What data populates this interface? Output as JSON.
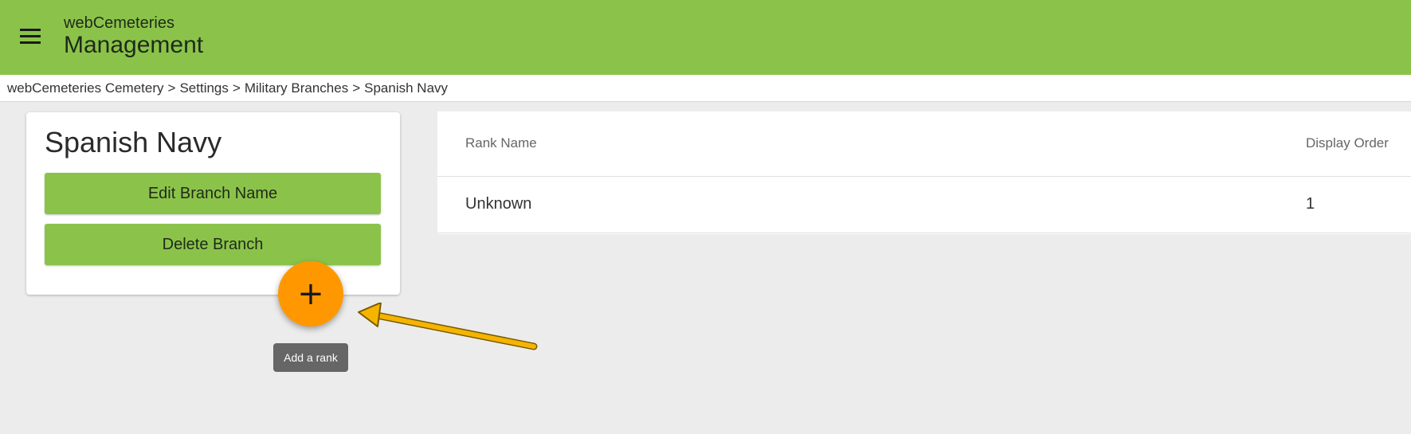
{
  "colors": {
    "appbar": "#8bc34a",
    "primary_button": "#8bc34a",
    "fab": "#ff9800",
    "annotation_arrow": "#f5b400",
    "content_bg": "#ececec"
  },
  "header": {
    "menu_icon": "hamburger-menu-icon",
    "app_name": "webCemeteries",
    "section_title": "Management"
  },
  "breadcrumb": {
    "separator": ">",
    "items": [
      "webCemeteries Cemetery",
      "Settings",
      "Military Branches",
      "Spanish Navy"
    ]
  },
  "branch_card": {
    "title": "Spanish Navy",
    "edit_label": "Edit Branch Name",
    "delete_label": "Delete Branch"
  },
  "rank_table": {
    "columns": [
      "Rank Name",
      "Display Order"
    ],
    "rows": [
      {
        "rank_name": "Unknown",
        "display_order": "1"
      }
    ]
  },
  "fab": {
    "icon": "plus-icon",
    "glyph": "+",
    "tooltip": "Add a rank"
  },
  "annotation": {
    "icon": "arrow-annotation-icon"
  }
}
